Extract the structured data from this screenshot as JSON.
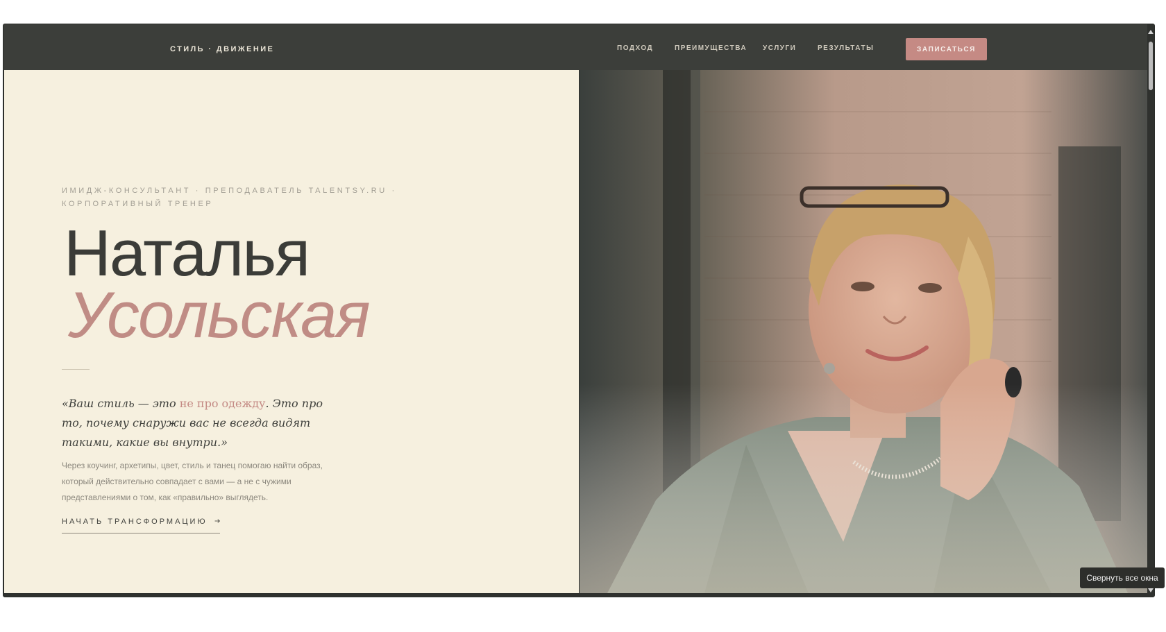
{
  "header": {
    "logo": "СТИЛЬ · ДВИЖЕНИЕ",
    "nav": [
      "ПОДХОД",
      "ПРЕИМУЩЕСТВА",
      "УСЛУГИ",
      "РЕЗУЛЬТАТЫ"
    ],
    "cta_label": "ЗАПИСАТЬСЯ"
  },
  "hero": {
    "eyebrow": "ИМИДЖ-КОНСУЛЬТАНТ · ПРЕПОДАВАТЕЛЬ TALENTSY.RU · КОРПОРАТИВНЫЙ ТРЕНЕР",
    "first_name": "Наталья",
    "last_name": "Усольская",
    "quote_before": "«Ваш стиль — это ",
    "quote_accent": "не про одежду",
    "quote_after": ". Это про то, почему снаружи вас не всегда видят такими, какие вы внутри.»",
    "description": "Через коучинг, архетипы, цвет, стиль и танец помогаю найти образ, который действительно совпадает с вами — а не с чужими представлениями о том, как «правильно» выглядеть.",
    "start_label": "НАЧАТЬ ТРАНСФОРМАЦИЮ"
  },
  "tooltip": "Свернуть все окна",
  "colors": {
    "nav_background": "#3c3e3a",
    "hero_background": "#f6f0df",
    "accent": "#c08c85",
    "cta_background": "#c58a84",
    "text_dark": "#3b3c38"
  }
}
